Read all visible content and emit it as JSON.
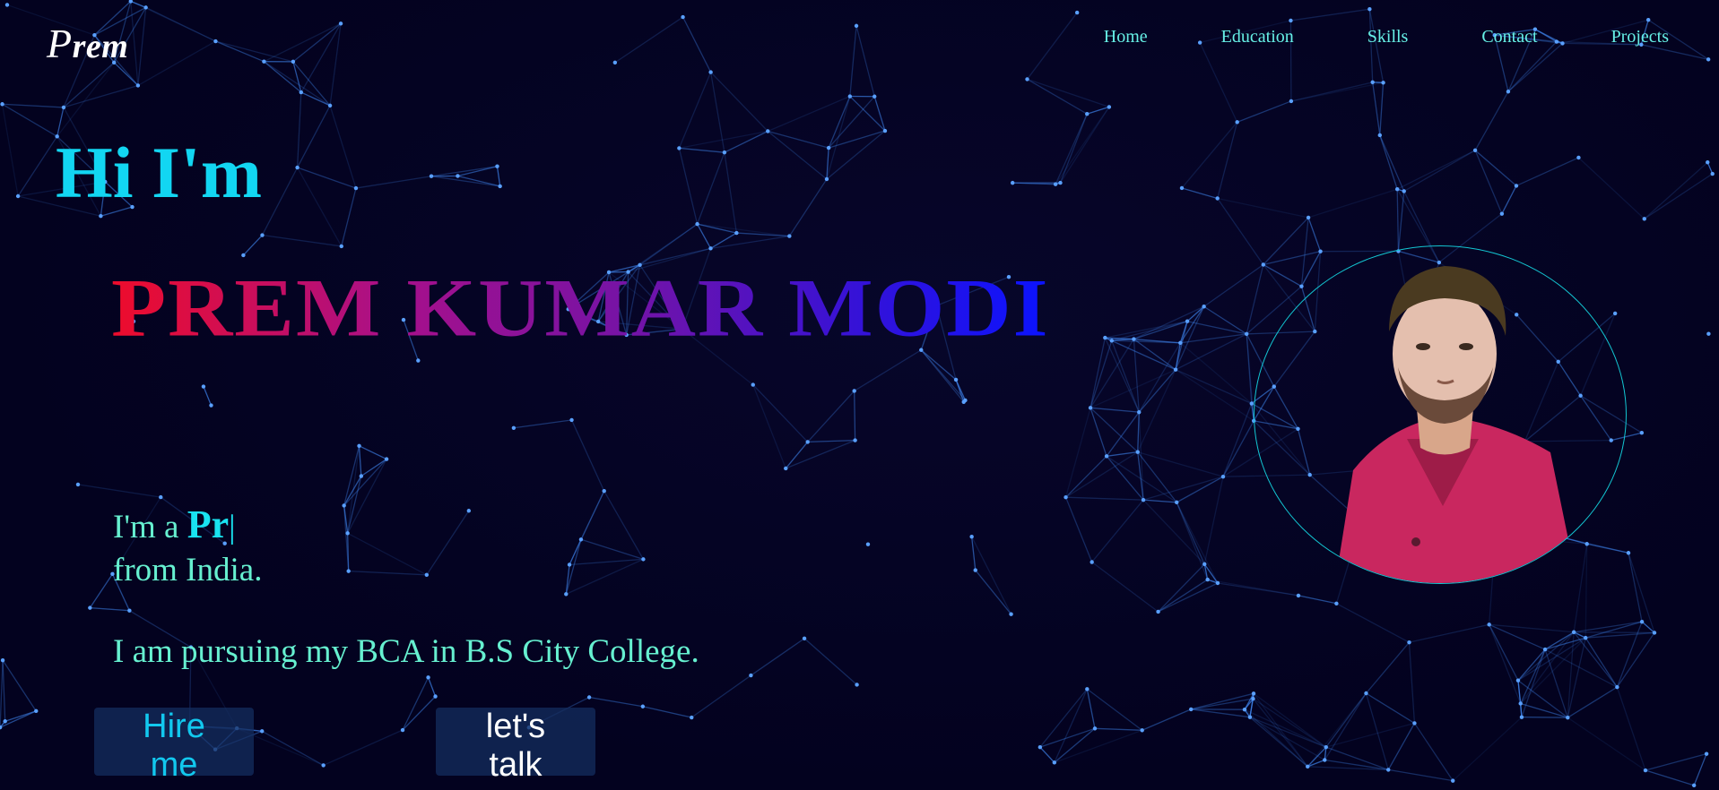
{
  "header": {
    "logo_initial": "P",
    "logo_rest": "rem",
    "nav": [
      {
        "label": "Home"
      },
      {
        "label": "Education"
      },
      {
        "label": "Skills"
      },
      {
        "label": "Contact"
      },
      {
        "label": "Projects"
      }
    ]
  },
  "hero": {
    "greeting": "Hi I'm",
    "name": "PREM KUMAR MODI",
    "intro_prefix": "I'm a ",
    "typed_role": "Pr",
    "caret": "|",
    "intro_suffix": "from India.",
    "education_line": "I am pursuing my BCA in B.S City College.",
    "hire_button": "Hire me",
    "talk_button": "let's talk"
  },
  "colors": {
    "background": "#03021f",
    "network_line": "#3f86f0",
    "nav_text": "#66f0e6",
    "greeting": "#12d6f2",
    "name_gradient_start": "#ee0c2b",
    "name_gradient_end": "#0a13ff",
    "body_text": "#66f0d0",
    "avatar_ring": "#13c6d2"
  },
  "avatar": {
    "icon": "profile-photo-icon"
  }
}
